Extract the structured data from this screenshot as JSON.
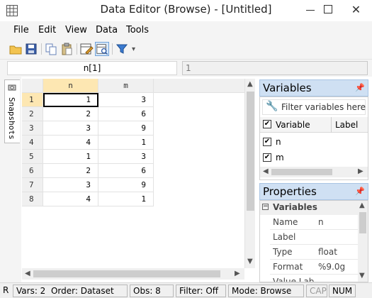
{
  "window": {
    "title": "Data Editor (Browse) - [Untitled]",
    "close_glyph": "✕"
  },
  "menu": {
    "items": [
      "File",
      "Edit",
      "View",
      "Data",
      "Tools"
    ]
  },
  "toolbar": {
    "icons": [
      "open-icon",
      "save-icon",
      "copy-icon",
      "paste-icon",
      "edit-mode-icon",
      "browse-mode-icon",
      "filter-icon"
    ]
  },
  "editbar": {
    "varname": "n[1]",
    "value": "1"
  },
  "snapshots": {
    "label": "Snapshots"
  },
  "grid": {
    "columns": [
      "n",
      "m"
    ],
    "rows": [
      {
        "num": "1",
        "n": "1",
        "m": "3"
      },
      {
        "num": "2",
        "n": "2",
        "m": "6"
      },
      {
        "num": "3",
        "n": "3",
        "m": "9"
      },
      {
        "num": "4",
        "n": "4",
        "m": "1"
      },
      {
        "num": "5",
        "n": "1",
        "m": "3"
      },
      {
        "num": "6",
        "n": "2",
        "m": "6"
      },
      {
        "num": "7",
        "n": "3",
        "m": "9"
      },
      {
        "num": "8",
        "n": "4",
        "m": "1"
      }
    ]
  },
  "variables": {
    "title": "Variables",
    "filter_placeholder": "Filter variables here",
    "col_variable": "Variable",
    "col_label": "Label",
    "items": [
      "n",
      "m"
    ]
  },
  "properties": {
    "title": "Properties",
    "section": "Variables",
    "rows": [
      {
        "key": "Name",
        "value": "n"
      },
      {
        "key": "Label",
        "value": ""
      },
      {
        "key": "Type",
        "value": "float"
      },
      {
        "key": "Format",
        "value": "%9.0g"
      },
      {
        "key": "Value Lab",
        "value": ""
      }
    ]
  },
  "status": {
    "r": "R",
    "vars": "Vars: 2",
    "order": "Order: Dataset",
    "obs": "Obs: 8",
    "filter": "Filter: Off",
    "mode": "Mode: Browse",
    "cap": "CAP",
    "num": "NUM"
  }
}
